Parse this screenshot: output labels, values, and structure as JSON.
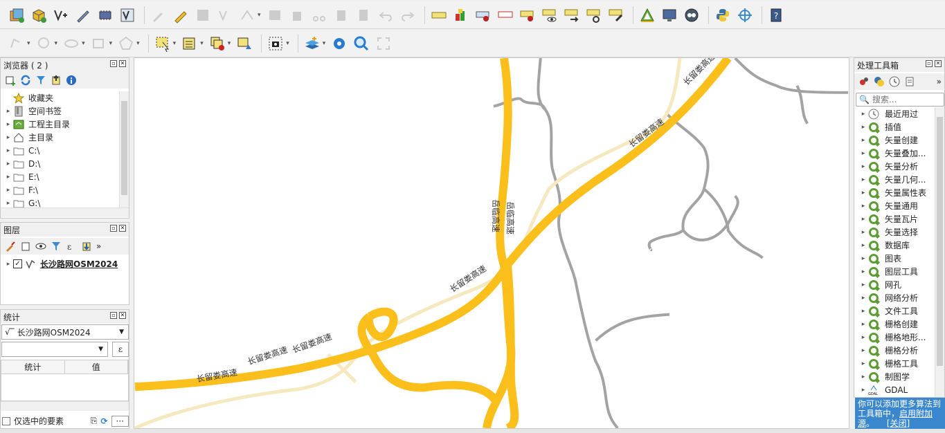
{
  "browser_panel": {
    "title": "浏览器 ( 2 )",
    "items": [
      {
        "label": "收藏夹",
        "icon": "star-icon",
        "expandable": false
      },
      {
        "label": "空间书签",
        "icon": "bookmark-icon",
        "expandable": true
      },
      {
        "label": "工程主目录",
        "icon": "project-home-icon",
        "expandable": true
      },
      {
        "label": "主目录",
        "icon": "home-icon",
        "expandable": true
      },
      {
        "label": "C:\\",
        "icon": "folder-icon",
        "expandable": true
      },
      {
        "label": "D:\\",
        "icon": "folder-icon",
        "expandable": true
      },
      {
        "label": "E:\\",
        "icon": "folder-icon",
        "expandable": true
      },
      {
        "label": "F:\\",
        "icon": "folder-icon",
        "expandable": true
      },
      {
        "label": "G:\\",
        "icon": "folder-icon",
        "expandable": true
      }
    ]
  },
  "layers_panel": {
    "title": "图层",
    "layers": [
      {
        "name": "长沙路网OSM2024",
        "checked": true,
        "icon": "line-layer-icon"
      }
    ]
  },
  "stats_panel": {
    "title": "统计",
    "layer_select": "长沙路网OSM2024",
    "field_value": "",
    "col_stat": "统计",
    "col_value": "值",
    "selected_only_label": "仅选中的要素",
    "more_label": "···"
  },
  "processing_panel": {
    "title": "处理工具箱",
    "search_placeholder": "搜索...",
    "items": [
      {
        "label": "最近用过",
        "icon": "clock-icon"
      },
      {
        "label": "插值",
        "icon": "qgis-icon"
      },
      {
        "label": "矢量创建",
        "icon": "qgis-icon"
      },
      {
        "label": "矢量叠加...",
        "icon": "qgis-icon"
      },
      {
        "label": "矢量分析",
        "icon": "qgis-icon"
      },
      {
        "label": "矢量几何...",
        "icon": "qgis-icon"
      },
      {
        "label": "矢量属性表",
        "icon": "qgis-icon"
      },
      {
        "label": "矢量通用",
        "icon": "qgis-icon"
      },
      {
        "label": "矢量瓦片",
        "icon": "qgis-icon"
      },
      {
        "label": "矢量选择",
        "icon": "qgis-icon"
      },
      {
        "label": "数据库",
        "icon": "qgis-icon"
      },
      {
        "label": "图表",
        "icon": "qgis-icon"
      },
      {
        "label": "图层工具",
        "icon": "qgis-icon"
      },
      {
        "label": "网孔",
        "icon": "qgis-icon"
      },
      {
        "label": "网络分析",
        "icon": "qgis-icon"
      },
      {
        "label": "文件工具",
        "icon": "qgis-icon"
      },
      {
        "label": "栅格创建",
        "icon": "qgis-icon"
      },
      {
        "label": "栅格地形...",
        "icon": "qgis-icon"
      },
      {
        "label": "栅格分析",
        "icon": "qgis-icon"
      },
      {
        "label": "栅格工具",
        "icon": "qgis-icon"
      },
      {
        "label": "制图学",
        "icon": "qgis-icon"
      },
      {
        "label": "GDAL",
        "icon": "gdal-icon"
      }
    ],
    "hint_text": "你可以添加更多算法到工具箱中，",
    "hint_link": "启用附加源",
    "hint_suffix": "。",
    "hint_close": "[关闭]"
  },
  "map": {
    "labels": [
      {
        "text": "长留娄高速"
      },
      {
        "text": "长留娄高速"
      },
      {
        "text": "长留娄高速"
      },
      {
        "text": "长留娄高速"
      },
      {
        "text": "长留娄高速"
      },
      {
        "text": "长留娄高速"
      },
      {
        "text": "岳临高速"
      },
      {
        "text": "岳临高速"
      }
    ],
    "colors": {
      "motorway": "#fbbf1c",
      "trunk": "#f6e9c0",
      "minor": "#a3a3a3"
    }
  }
}
